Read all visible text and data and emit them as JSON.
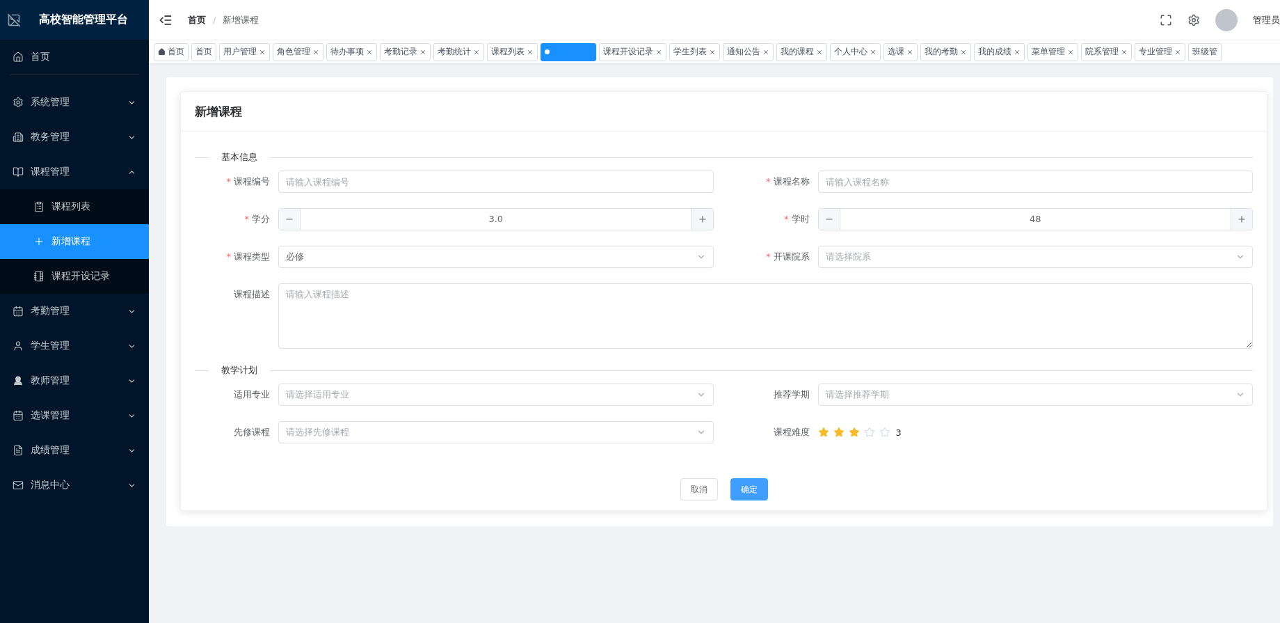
{
  "app": {
    "title": "高校智能管理平台"
  },
  "sidebar": {
    "items": [
      {
        "label": "首页"
      },
      {
        "label": "系统管理",
        "expanded": false
      },
      {
        "label": "教务管理",
        "expanded": false
      },
      {
        "label": "课程管理",
        "expanded": true,
        "children": [
          {
            "label": "课程列表",
            "selected": false
          },
          {
            "label": "新增课程",
            "selected": true
          },
          {
            "label": "课程开设记录",
            "selected": false
          }
        ]
      },
      {
        "label": "考勤管理",
        "expanded": false
      },
      {
        "label": "学生管理",
        "expanded": false
      },
      {
        "label": "教师管理",
        "expanded": false
      },
      {
        "label": "选课管理",
        "expanded": false
      },
      {
        "label": "成绩管理",
        "expanded": false
      },
      {
        "label": "消息中心",
        "expanded": false
      }
    ]
  },
  "header": {
    "breadcrumb": [
      "首页",
      "新增课程"
    ],
    "separator": "/",
    "user": "管理员"
  },
  "tabs": [
    {
      "label": "首页",
      "home": true,
      "closable": false,
      "selected": false
    },
    {
      "label": "首页",
      "closable": false,
      "selected": false
    },
    {
      "label": "用户管理",
      "closable": true,
      "selected": false
    },
    {
      "label": "角色管理",
      "closable": true,
      "selected": false
    },
    {
      "label": "待办事项",
      "closable": true,
      "selected": false
    },
    {
      "label": "考勤记录",
      "closable": true,
      "selected": false
    },
    {
      "label": "考勤统计",
      "closable": true,
      "selected": false
    },
    {
      "label": "课程列表",
      "closable": true,
      "selected": false
    },
    {
      "closable": false,
      "selected": true
    },
    {
      "label": "课程开设记录",
      "closable": true,
      "selected": false
    },
    {
      "label": "学生列表",
      "closable": true,
      "selected": false
    },
    {
      "label": "通知公告",
      "closable": true,
      "selected": false
    },
    {
      "label": "我的课程",
      "closable": true,
      "selected": false
    },
    {
      "label": "个人中心",
      "closable": true,
      "selected": false
    },
    {
      "label": "选课",
      "closable": true,
      "selected": false
    },
    {
      "label": "我的考勤",
      "closable": true,
      "selected": false
    },
    {
      "label": "我的成绩",
      "closable": true,
      "selected": false
    },
    {
      "label": "菜单管理",
      "closable": true,
      "selected": false
    },
    {
      "label": "院系管理",
      "closable": true,
      "selected": false
    },
    {
      "label": "专业管理",
      "closable": true,
      "selected": false
    },
    {
      "label": "班级管",
      "closable": false,
      "selected": false
    }
  ],
  "card": {
    "title": "新增课程",
    "sections": [
      {
        "title": "基本信息",
        "fields": [
          {
            "kind": "input",
            "required_mark": "*",
            "label": "课程编号",
            "placeholder": "请输入课程编号"
          },
          {
            "kind": "input",
            "required_mark": "*",
            "label": "课程名称",
            "placeholder": "请输入课程名称"
          },
          {
            "kind": "number",
            "required_mark": "*",
            "label": "学分",
            "value": "3.0"
          },
          {
            "kind": "number",
            "required_mark": "*",
            "label": "学时",
            "value": "48"
          },
          {
            "kind": "select",
            "required_mark": "*",
            "label": "课程类型",
            "value": "必修"
          },
          {
            "kind": "select",
            "required_mark": "*",
            "label": "开课院系",
            "placeholder": "请选择院系"
          },
          {
            "kind": "textarea",
            "label": "课程描述",
            "placeholder": "请输入课程描述"
          }
        ]
      },
      {
        "title": "教学计划",
        "fields": [
          {
            "kind": "select",
            "label": "适用专业",
            "placeholder": "请选择适用专业"
          },
          {
            "kind": "select",
            "label": "推荐学期",
            "placeholder": "请选择推荐学期"
          },
          {
            "kind": "select",
            "label": "先修课程",
            "placeholder": "请选择先修课程"
          },
          {
            "kind": "rating",
            "label": "课程难度",
            "stars": 3,
            "reading": "3"
          }
        ]
      }
    ],
    "buttons": [
      {
        "label": "取消",
        "kind": "default"
      },
      {
        "label": "确定",
        "kind": "primary"
      }
    ]
  }
}
